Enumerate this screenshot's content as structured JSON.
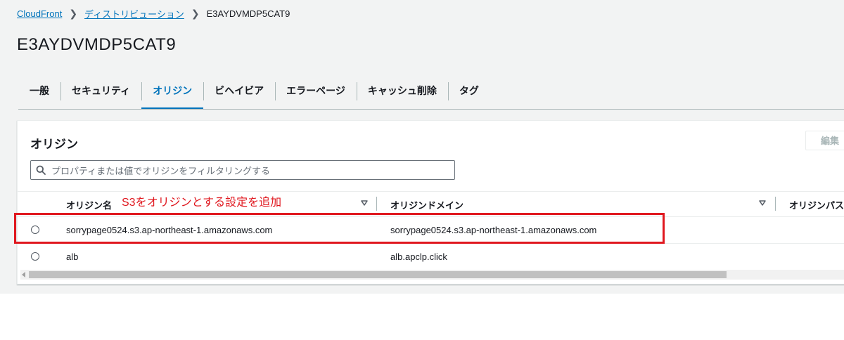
{
  "breadcrumb": {
    "items": [
      "CloudFront",
      "ディストリビューション"
    ],
    "current": "E3AYDVMDP5CAT9"
  },
  "page_title": "E3AYDVMDP5CAT9",
  "tabs": [
    {
      "label": "一般",
      "active": false
    },
    {
      "label": "セキュリティ",
      "active": false
    },
    {
      "label": "オリジン",
      "active": true
    },
    {
      "label": "ビヘイビア",
      "active": false
    },
    {
      "label": "エラーページ",
      "active": false
    },
    {
      "label": "キャッシュ削除",
      "active": false
    },
    {
      "label": "タグ",
      "active": false
    }
  ],
  "origins_panel": {
    "title": "オリジン",
    "edit_label": "編集",
    "search": {
      "placeholder": "プロパティまたは値でオリジンをフィルタリングする",
      "value": ""
    },
    "columns": [
      "オリジン名",
      "オリジンドメイン",
      "オリジンパス"
    ],
    "rows": [
      {
        "name": "sorrypage0524.s3.ap-northeast-1.amazonaws.com",
        "domain": "sorrypage0524.s3.ap-northeast-1.amazonaws.com"
      },
      {
        "name": "alb",
        "domain": "alb.apclp.click"
      }
    ]
  },
  "annotation": {
    "text": "S3をオリジンとする設定を追加",
    "color": "#e0181f"
  },
  "colors": {
    "accent": "#0073bb",
    "background": "#f2f3f3"
  }
}
